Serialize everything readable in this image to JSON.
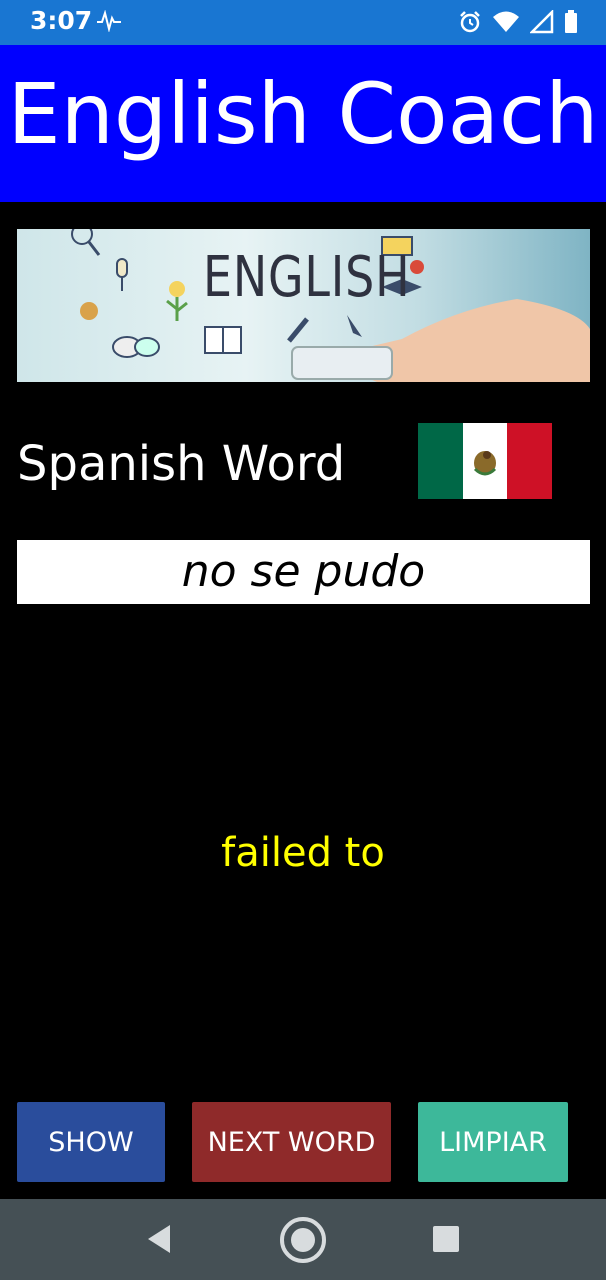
{
  "status_bar": {
    "time": "3:07",
    "icons": [
      "pulse-icon",
      "alarm-icon",
      "wifi-icon",
      "signal-icon",
      "battery-icon"
    ]
  },
  "header": {
    "title": "English Coach"
  },
  "banner": {
    "text": "ENGLISH"
  },
  "spanish": {
    "label": "Spanish Word",
    "flag": "mexico-flag"
  },
  "word": {
    "value": "no se pudo"
  },
  "translation": {
    "value": "failed to"
  },
  "buttons": {
    "show": "SHOW",
    "next": "NEXT WORD",
    "clear": "LIMPIAR"
  },
  "colors": {
    "status_bar": "#1976d2",
    "title_bar": "#0000ff",
    "translation": "#ffff00",
    "show": "#2a4d9c",
    "next": "#8f2a2a",
    "clear": "#3db89a",
    "nav_bar": "#455055"
  },
  "nav": {
    "icons": [
      "back-icon",
      "home-icon",
      "recents-icon"
    ]
  }
}
